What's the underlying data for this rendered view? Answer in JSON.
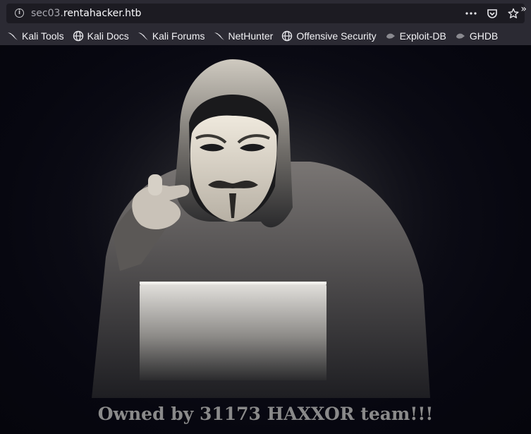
{
  "browser": {
    "url_subdomain": "sec03.",
    "url_domain": "rentahacker.htb",
    "bookmarks": [
      {
        "label": "Kali Tools",
        "icon": "kali-dragon-icon"
      },
      {
        "label": "Kali Docs",
        "icon": "globe-icon"
      },
      {
        "label": "Kali Forums",
        "icon": "kali-dragon-icon"
      },
      {
        "label": "NetHunter",
        "icon": "kali-dragon-icon"
      },
      {
        "label": "Offensive Security",
        "icon": "globe-icon"
      },
      {
        "label": "Exploit-DB",
        "icon": "exploit-db-icon"
      },
      {
        "label": "GHDB",
        "icon": "exploit-db-icon"
      }
    ],
    "overflow_label": "»"
  },
  "page": {
    "caption": "Owned by 31173 HAXXOR team!!!"
  },
  "colors": {
    "chrome_bg": "#2b2a33",
    "urlbar_bg": "#1c1b22",
    "page_bg": "#0a0a14",
    "caption": "#8a8a8a"
  }
}
